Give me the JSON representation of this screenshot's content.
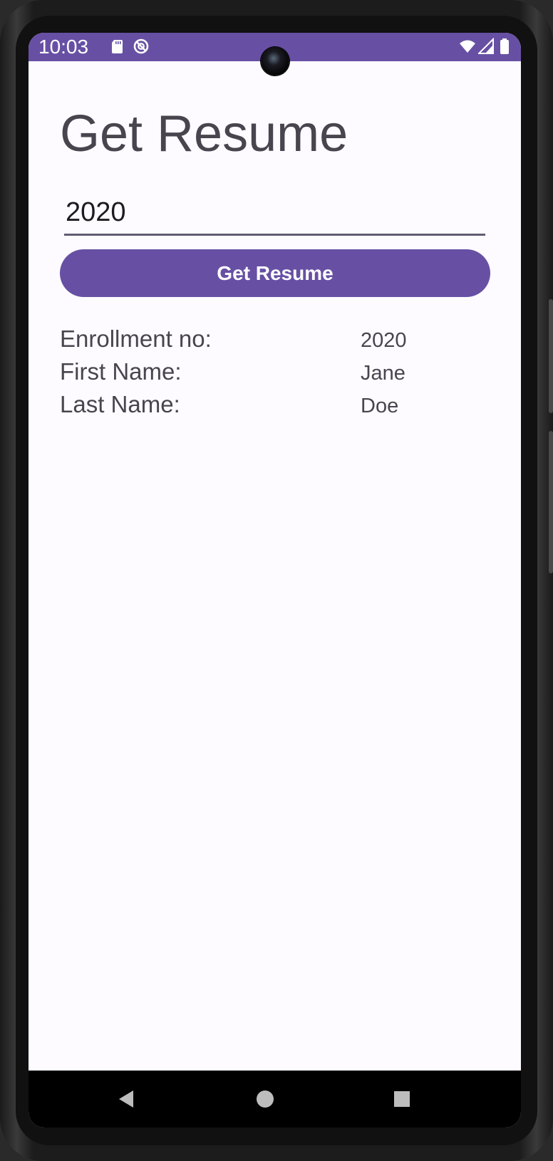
{
  "status_bar": {
    "time": "10:03",
    "icons": [
      "sd-card-icon",
      "no-disturb-icon",
      "wifi-icon",
      "signal-icon",
      "battery-icon"
    ],
    "background_color": "#6750a4"
  },
  "app": {
    "title": "Get Resume",
    "input": {
      "value": "2020",
      "placeholder": ""
    },
    "button_label": "Get Resume",
    "accent_color": "#6750a4"
  },
  "resume": {
    "fields": [
      {
        "label": "Enrollment no:",
        "value": "2020"
      },
      {
        "label": "First Name:",
        "value": "Jane"
      },
      {
        "label": "Last Name:",
        "value": "Doe"
      }
    ]
  },
  "nav_bar": {
    "buttons": [
      "back-icon",
      "home-icon",
      "recents-icon"
    ]
  }
}
